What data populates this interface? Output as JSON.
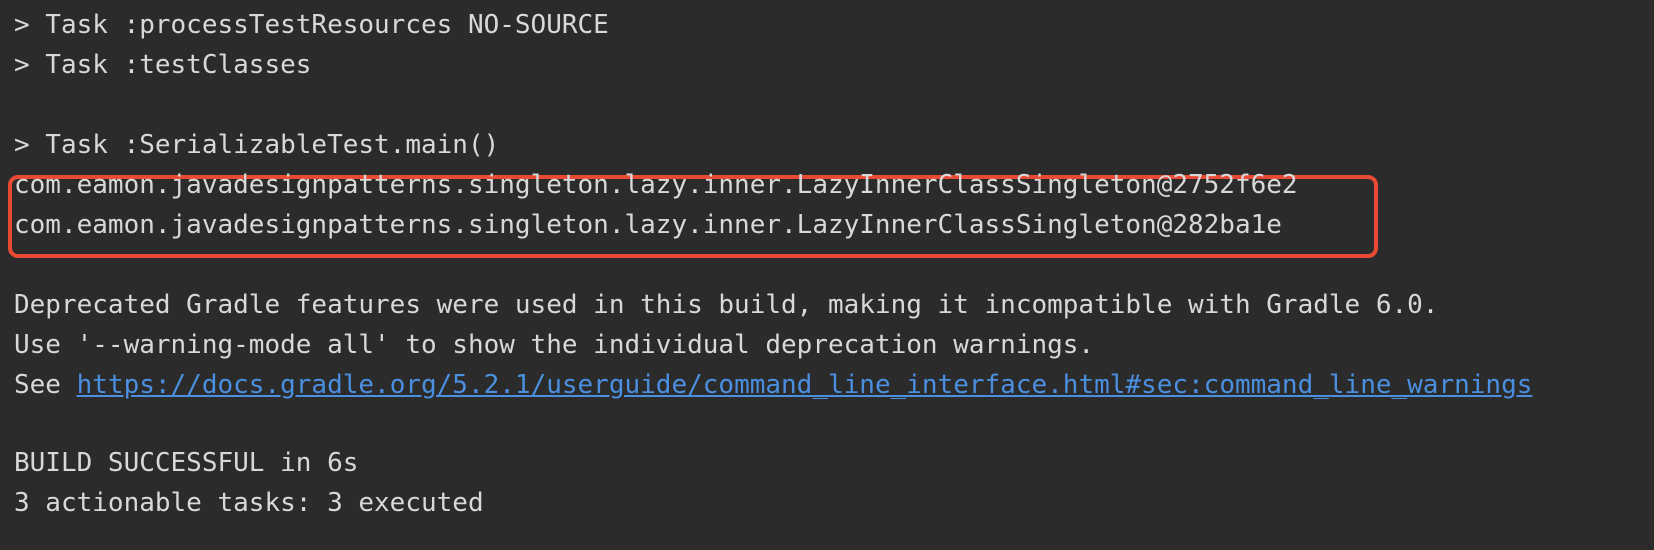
{
  "console": {
    "lines": [
      "> Task :processTestResources NO-SOURCE",
      "> Task :testClasses",
      "> Task :SerializableTest.main()",
      "com.eamon.javadesignpatterns.singleton.lazy.inner.LazyInnerClassSingleton@2752f6e2",
      "com.eamon.javadesignpatterns.singleton.lazy.inner.LazyInnerClassSingleton@282ba1e",
      "Deprecated Gradle features were used in this build, making it incompatible with Gradle 6.0.",
      "Use '--warning-mode all' to show the individual deprecation warnings.",
      "BUILD SUCCESSFUL in 6s",
      "3 actionable tasks: 3 executed"
    ],
    "see_prefix": "See ",
    "link_text": "https://docs.gradle.org/5.2.1/userguide/command_line_interface.html#sec:command_line_warnings"
  },
  "colors": {
    "background": "#2b2b2b",
    "text": "#d8d8d8",
    "link": "#4a8fe0",
    "highlight": "#e84a33"
  }
}
